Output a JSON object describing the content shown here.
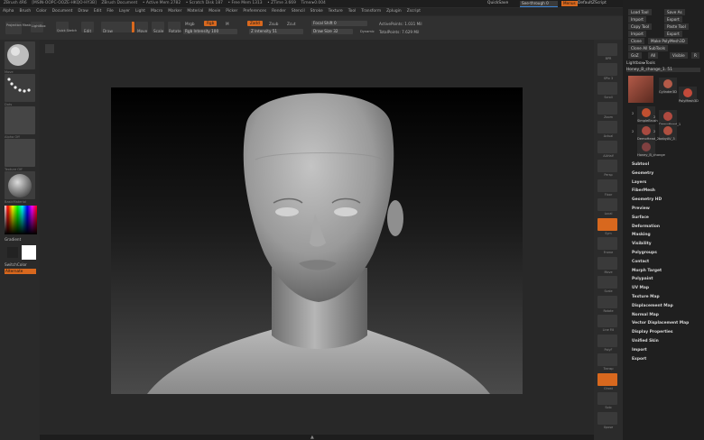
{
  "titlebar": {
    "app": "ZBrush 4R6",
    "build": "[MSIN-OOPC-OOZE-HKQO-HY3B]",
    "document": "ZBrush Document",
    "active_mem": "• Active Mem 2782",
    "scratch": "• Scratch Disk 187",
    "free_mem": "• Free Mem 1313",
    "ztime": "• ZTime 3.669",
    "timer": "Timer▸0.004",
    "quicksave": "QuickSave",
    "seethrough": "See-through  0",
    "menus": "Menus",
    "defaultscript": "DefaultZScript"
  },
  "menubar": [
    "Alpha",
    "Brush",
    "Color",
    "Document",
    "Draw",
    "Edit",
    "File",
    "Layer",
    "Light",
    "Macro",
    "Marker",
    "Material",
    "Movie",
    "Picker",
    "Preferences",
    "Render",
    "Stencil",
    "Stroke",
    "Texture",
    "Tool",
    "Transform",
    "Zplugin",
    "Zscript"
  ],
  "toolbar": {
    "projection_master": "Projection Master",
    "lightbox": "LightBox",
    "quick_sketch": "Quick Sketch",
    "edit": "Edit",
    "draw": "Draw",
    "move": "Move",
    "scale": "Scale",
    "rotate": "Rotate",
    "mrgb": "Mrgb",
    "rgb": "Rgb",
    "m": "M",
    "zadd": "Zadd",
    "zsub": "Zsub",
    "zcut": "Zcut",
    "rgb_intensity": "Rgb Intensity 100",
    "z_intensity": "Z Intensity 51",
    "focal_shift": "Focal Shift 0",
    "draw_size": "Draw Size 32",
    "dynamic": "Dynamic",
    "active_points": "ActivePoints: 1.031 Mil",
    "total_points": "TotalPoints: 7.629 Mil"
  },
  "leftshelf": {
    "tiles": [
      "Move",
      "Dots",
      "Alpha Off",
      "Texture Off",
      "BasicMaterial"
    ],
    "gradient": "Gradient",
    "switch_color": "SwitchColor",
    "alternate": "Alternate"
  },
  "rightshelf": [
    "BPR",
    "SPix 3",
    "Scroll",
    "Zoom",
    "Actual",
    "AAHalf",
    "Persp",
    "Floor",
    "Local",
    "Sym",
    "Frame",
    "Move",
    "Scale",
    "Rotate",
    "Line Fill",
    "PolyF",
    "Transp",
    "Ghost",
    "Solo",
    "Xpose"
  ],
  "tray": {
    "top_buttons": [
      "Load Tool",
      "Save As",
      "Copy Tool",
      "Paste Tool",
      "Import",
      "Export"
    ],
    "clone": "Clone",
    "make_polymesh": "Make PolyMesh3D",
    "goz": "GoZ",
    "all": "All",
    "visible": "Visible",
    "r": "R",
    "clone_all_subtools": "Clone All SubTools",
    "lightbox_tools": "Lightbox▸Tools",
    "current_tool": "Honey_B_change_1. 51",
    "subtools": [
      {
        "name": "Cylinder3D",
        "count": ""
      },
      {
        "name": "PolyMesh3D",
        "count": ""
      },
      {
        "name": "SimpleBrush",
        "count": "2"
      },
      {
        "name": "DemoHead_1",
        "count": "2"
      },
      {
        "name": "DemoHead_2",
        "count": "2"
      },
      {
        "name": "babyAV_3",
        "count": "2"
      },
      {
        "name": "Honey_B_change",
        "count": ""
      }
    ],
    "menu": [
      "Subtool",
      "Geometry",
      "Layers",
      "FiberMesh",
      "Geometry HD",
      "Preview",
      "Surface",
      "Deformation",
      "Masking",
      "Visibility",
      "Polygroups",
      "Contact",
      "Morph Target",
      "Polypaint",
      "UV Map",
      "Texture Map",
      "Displacement Map",
      "Normal Map",
      "Vector Displacement Map",
      "Display Properties",
      "Unified Skin",
      "Import",
      "Export"
    ]
  },
  "colors": {
    "accent": "#d8681e",
    "panel": "#303030",
    "tray": "#1f1f1f"
  }
}
